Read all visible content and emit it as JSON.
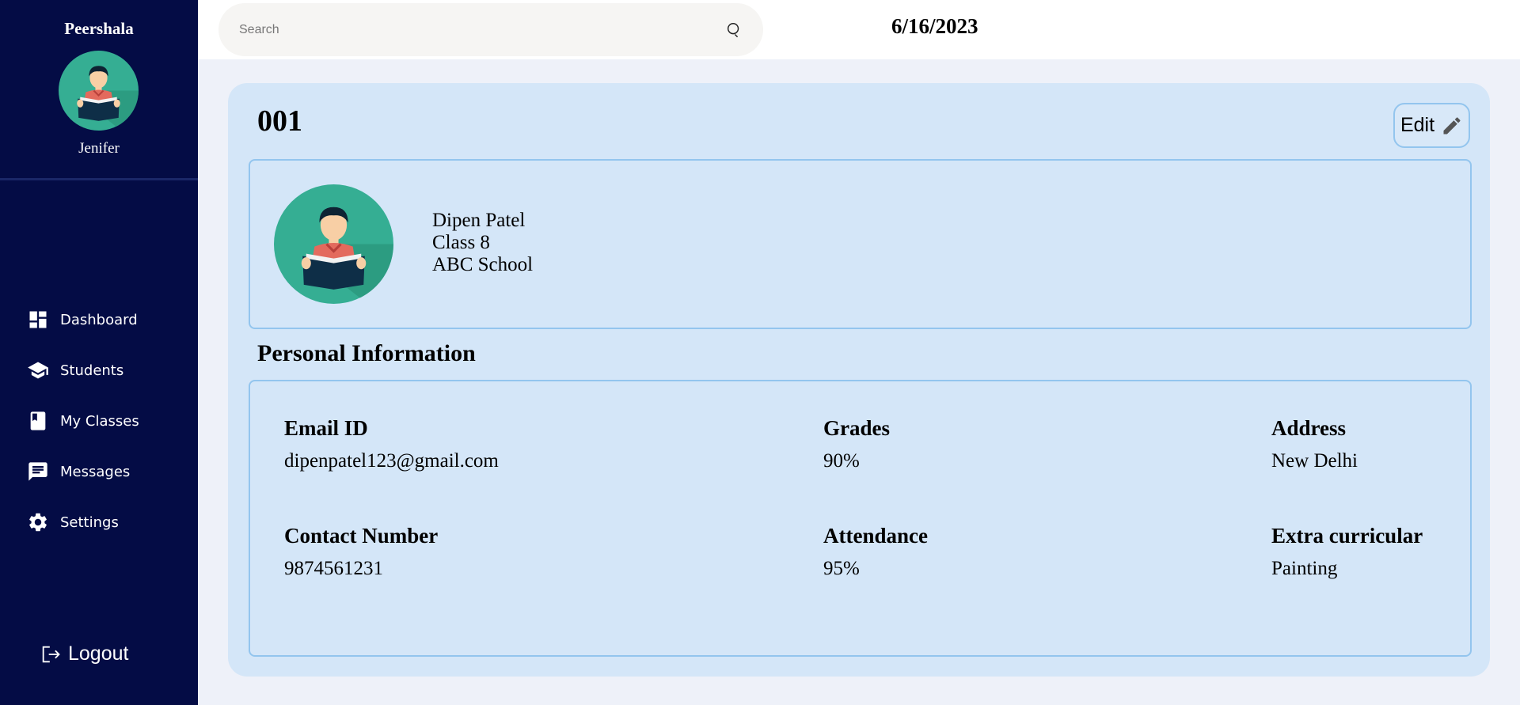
{
  "sidebar": {
    "brand": "Peershala",
    "user_name": "Jenifer",
    "nav": [
      {
        "label": "Dashboard",
        "icon": "dashboard-icon"
      },
      {
        "label": "Students",
        "icon": "graduation-cap-icon"
      },
      {
        "label": "My Classes",
        "icon": "book-icon"
      },
      {
        "label": "Messages",
        "icon": "message-icon"
      },
      {
        "label": "Settings",
        "icon": "gear-icon"
      }
    ],
    "logout_label": "Logout"
  },
  "topbar": {
    "search_placeholder": "Search",
    "date": "6/16/2023"
  },
  "student": {
    "id": "001",
    "edit_label": "Edit",
    "name": "Dipen Patel",
    "class": "Class 8",
    "school": "ABC School"
  },
  "personal_info": {
    "title": "Personal Information",
    "fields": [
      {
        "label": "Email ID",
        "value": "dipenpatel123@gmail.com"
      },
      {
        "label": "Grades",
        "value": "90%"
      },
      {
        "label": "Address",
        "value": "New Delhi"
      },
      {
        "label": "Contact Number",
        "value": "9874561231"
      },
      {
        "label": "Attendance",
        "value": "95%"
      },
      {
        "label": "Extra curricular",
        "value": "Painting"
      }
    ]
  },
  "colors": {
    "sidebar_bg": "#040c45",
    "page_bg": "#eef1f9",
    "card_bg": "#d4e6f8",
    "border": "#93c5ee",
    "avatar_bg": "#2eaa8f"
  }
}
